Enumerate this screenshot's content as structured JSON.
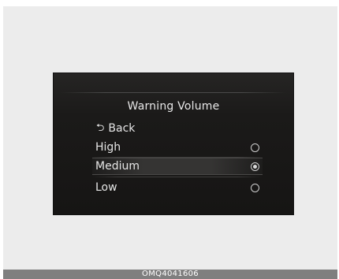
{
  "screen": {
    "title": "Warning Volume",
    "back_label": "Back",
    "back_icon": "return-arrow-icon",
    "options": [
      {
        "label": "High",
        "selected": false
      },
      {
        "label": "Medium",
        "selected": true
      },
      {
        "label": "Low",
        "selected": false
      }
    ]
  },
  "caption": "OMQ4041606",
  "colors": {
    "screen_background": "#1c1b1a",
    "text": "#e6e6e6",
    "caption_bar": "#7f7f7f",
    "frame_background": "#ececec"
  }
}
